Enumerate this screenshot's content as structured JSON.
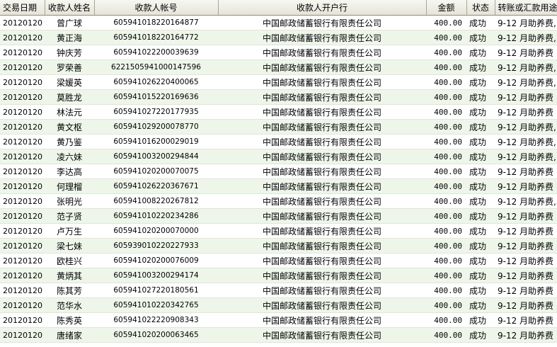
{
  "headers": {
    "date": "交易日期",
    "name": "收款人姓名",
    "account": "收款人帐号",
    "bank": "收款人开户行",
    "amount": "金额",
    "status": "状态",
    "usage": "转账或汇款用途"
  },
  "rows": [
    {
      "date": "20120120",
      "name": "曾广球",
      "account": "605941018220164877",
      "bank": "中国邮政储蓄银行有限责任公司",
      "amount": "400.00",
      "status": "成功",
      "usage": "9-12 月助养费,"
    },
    {
      "date": "20120120",
      "name": "黄正海",
      "account": "605941018220164772",
      "bank": "中国邮政储蓄银行有限责任公司",
      "amount": "400.00",
      "status": "成功",
      "usage": "9-12 月助养费,"
    },
    {
      "date": "20120120",
      "name": "钟庆芳",
      "account": "605941022200039639",
      "bank": "中国邮政储蓄银行有限责任公司",
      "amount": "400.00",
      "status": "成功",
      "usage": "9-12 月助养费"
    },
    {
      "date": "20120120",
      "name": "罗荣善",
      "account": "6221505941000147596",
      "bank": "中国邮政储蓄银行有限责任公司",
      "amount": "400.00",
      "status": "成功",
      "usage": "9-12 月助养费,"
    },
    {
      "date": "20120120",
      "name": "梁媛英",
      "account": "605941026220400065",
      "bank": "中国邮政储蓄银行有限责任公司",
      "amount": "400.00",
      "status": "成功",
      "usage": "9-12 月助养费,"
    },
    {
      "date": "20120120",
      "name": "莫胜龙",
      "account": "605941015220169636",
      "bank": "中国邮政储蓄银行有限责任公司",
      "amount": "400.00",
      "status": "成功",
      "usage": "9-12 月助养费"
    },
    {
      "date": "20120120",
      "name": "林法元",
      "account": "605941027220177935",
      "bank": "中国邮政储蓄银行有限责任公司",
      "amount": "400.00",
      "status": "成功",
      "usage": "9-12 月助养费"
    },
    {
      "date": "20120120",
      "name": "黄文枢",
      "account": "605941029200078770",
      "bank": "中国邮政储蓄银行有限责任公司",
      "amount": "400.00",
      "status": "成功",
      "usage": "9-12 月助养费,"
    },
    {
      "date": "20120120",
      "name": "黄乃鉴",
      "account": "605941016200029019",
      "bank": "中国邮政储蓄银行有限责任公司",
      "amount": "400.00",
      "status": "成功",
      "usage": "9-12 月助养费,"
    },
    {
      "date": "20120120",
      "name": "凌六妹",
      "account": "605941003200294844",
      "bank": "中国邮政储蓄银行有限责任公司",
      "amount": "400.00",
      "status": "成功",
      "usage": "9-12 月助养费,"
    },
    {
      "date": "20120120",
      "name": "李达高",
      "account": "605941020200070075",
      "bank": "中国邮政储蓄银行有限责任公司",
      "amount": "400.00",
      "status": "成功",
      "usage": "9-12 月助养费"
    },
    {
      "date": "20120120",
      "name": "何理榴",
      "account": "605941026220367671",
      "bank": "中国邮政储蓄银行有限责任公司",
      "amount": "400.00",
      "status": "成功",
      "usage": "9-12 月助养费"
    },
    {
      "date": "20120120",
      "name": "张明光",
      "account": "605941008220267812",
      "bank": "中国邮政储蓄银行有限责任公司",
      "amount": "400.00",
      "status": "成功",
      "usage": "9-12 月助养费,"
    },
    {
      "date": "20120120",
      "name": "范子贤",
      "account": "605941010220234286",
      "bank": "中国邮政储蓄银行有限责任公司",
      "amount": "400.00",
      "status": "成功",
      "usage": "9-12 月助养费"
    },
    {
      "date": "20120120",
      "name": "卢万生",
      "account": "605941020200070000",
      "bank": "中国邮政储蓄银行有限责任公司",
      "amount": "400.00",
      "status": "成功",
      "usage": "9-12 月助养费"
    },
    {
      "date": "20120120",
      "name": "梁七妹",
      "account": "605939010220227933",
      "bank": "中国邮政储蓄银行有限责任公司",
      "amount": "400.00",
      "status": "成功",
      "usage": "9-12 月助养费"
    },
    {
      "date": "20120120",
      "name": "欧桂兴",
      "account": "605941020200076009",
      "bank": "中国邮政储蓄银行有限责任公司",
      "amount": "400.00",
      "status": "成功",
      "usage": "9-12 月助养费"
    },
    {
      "date": "20120120",
      "name": "黄炳其",
      "account": "605941003200294174",
      "bank": "中国邮政储蓄银行有限责任公司",
      "amount": "400.00",
      "status": "成功",
      "usage": "9-12 月助养费"
    },
    {
      "date": "20120120",
      "name": "陈其芳",
      "account": "605941027220180561",
      "bank": "中国邮政储蓄银行有限责任公司",
      "amount": "400.00",
      "status": "成功",
      "usage": "9-12 月助养费"
    },
    {
      "date": "20120120",
      "name": "范华水",
      "account": "605941010220342765",
      "bank": "中国邮政储蓄银行有限责任公司",
      "amount": "400.00",
      "status": "成功",
      "usage": "9-12 月助养费"
    },
    {
      "date": "20120120",
      "name": "陈秀英",
      "account": "605941022220908343",
      "bank": "中国邮政储蓄银行有限责任公司",
      "amount": "400.00",
      "status": "成功",
      "usage": "9-12 月助养费"
    },
    {
      "date": "20120120",
      "name": "唐绪家",
      "account": "605941020200063465",
      "bank": "中国邮政储蓄银行有限责任公司",
      "amount": "400.00",
      "status": "成功",
      "usage": "9-12 月助养费"
    }
  ]
}
